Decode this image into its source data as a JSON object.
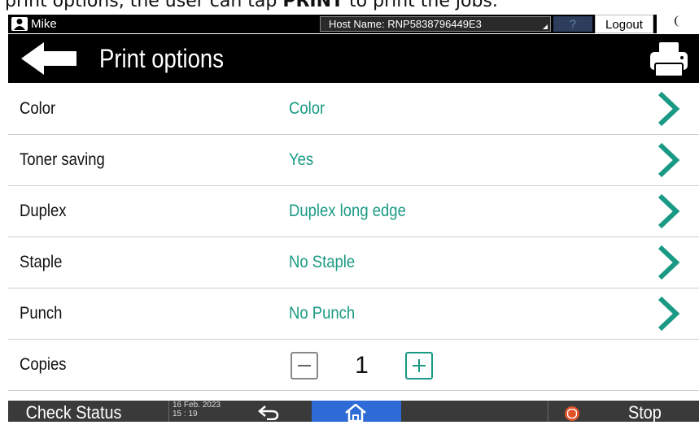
{
  "caption": {
    "prefix": "print options, the user can tap ",
    "bold": "PRINT",
    "suffix": " to print the jobs."
  },
  "topbar": {
    "user_name": "Mike",
    "host_label": "Host Name: RNP5838796449E3",
    "help_label": "?",
    "logout_label": "Logout",
    "moon_label": "("
  },
  "header": {
    "title": "Print options",
    "icons": [
      "back-arrow-icon",
      "printer-icon"
    ]
  },
  "options": [
    {
      "label": "Color",
      "value": "Color"
    },
    {
      "label": "Toner saving",
      "value": "Yes"
    },
    {
      "label": "Duplex",
      "value": "Duplex long edge"
    },
    {
      "label": "Staple",
      "value": "No Staple"
    },
    {
      "label": "Punch",
      "value": "No Punch"
    }
  ],
  "copies": {
    "label": "Copies",
    "value": "1"
  },
  "bottombar": {
    "check_status": "Check Status",
    "date_line1": "16 Feb. 2023",
    "date_line2": "15 : 19",
    "stop_label": "Stop"
  },
  "colors": {
    "accent": "#1a9a84",
    "home_blue": "#2f6bd6",
    "stop_orange": "#e0542a"
  }
}
